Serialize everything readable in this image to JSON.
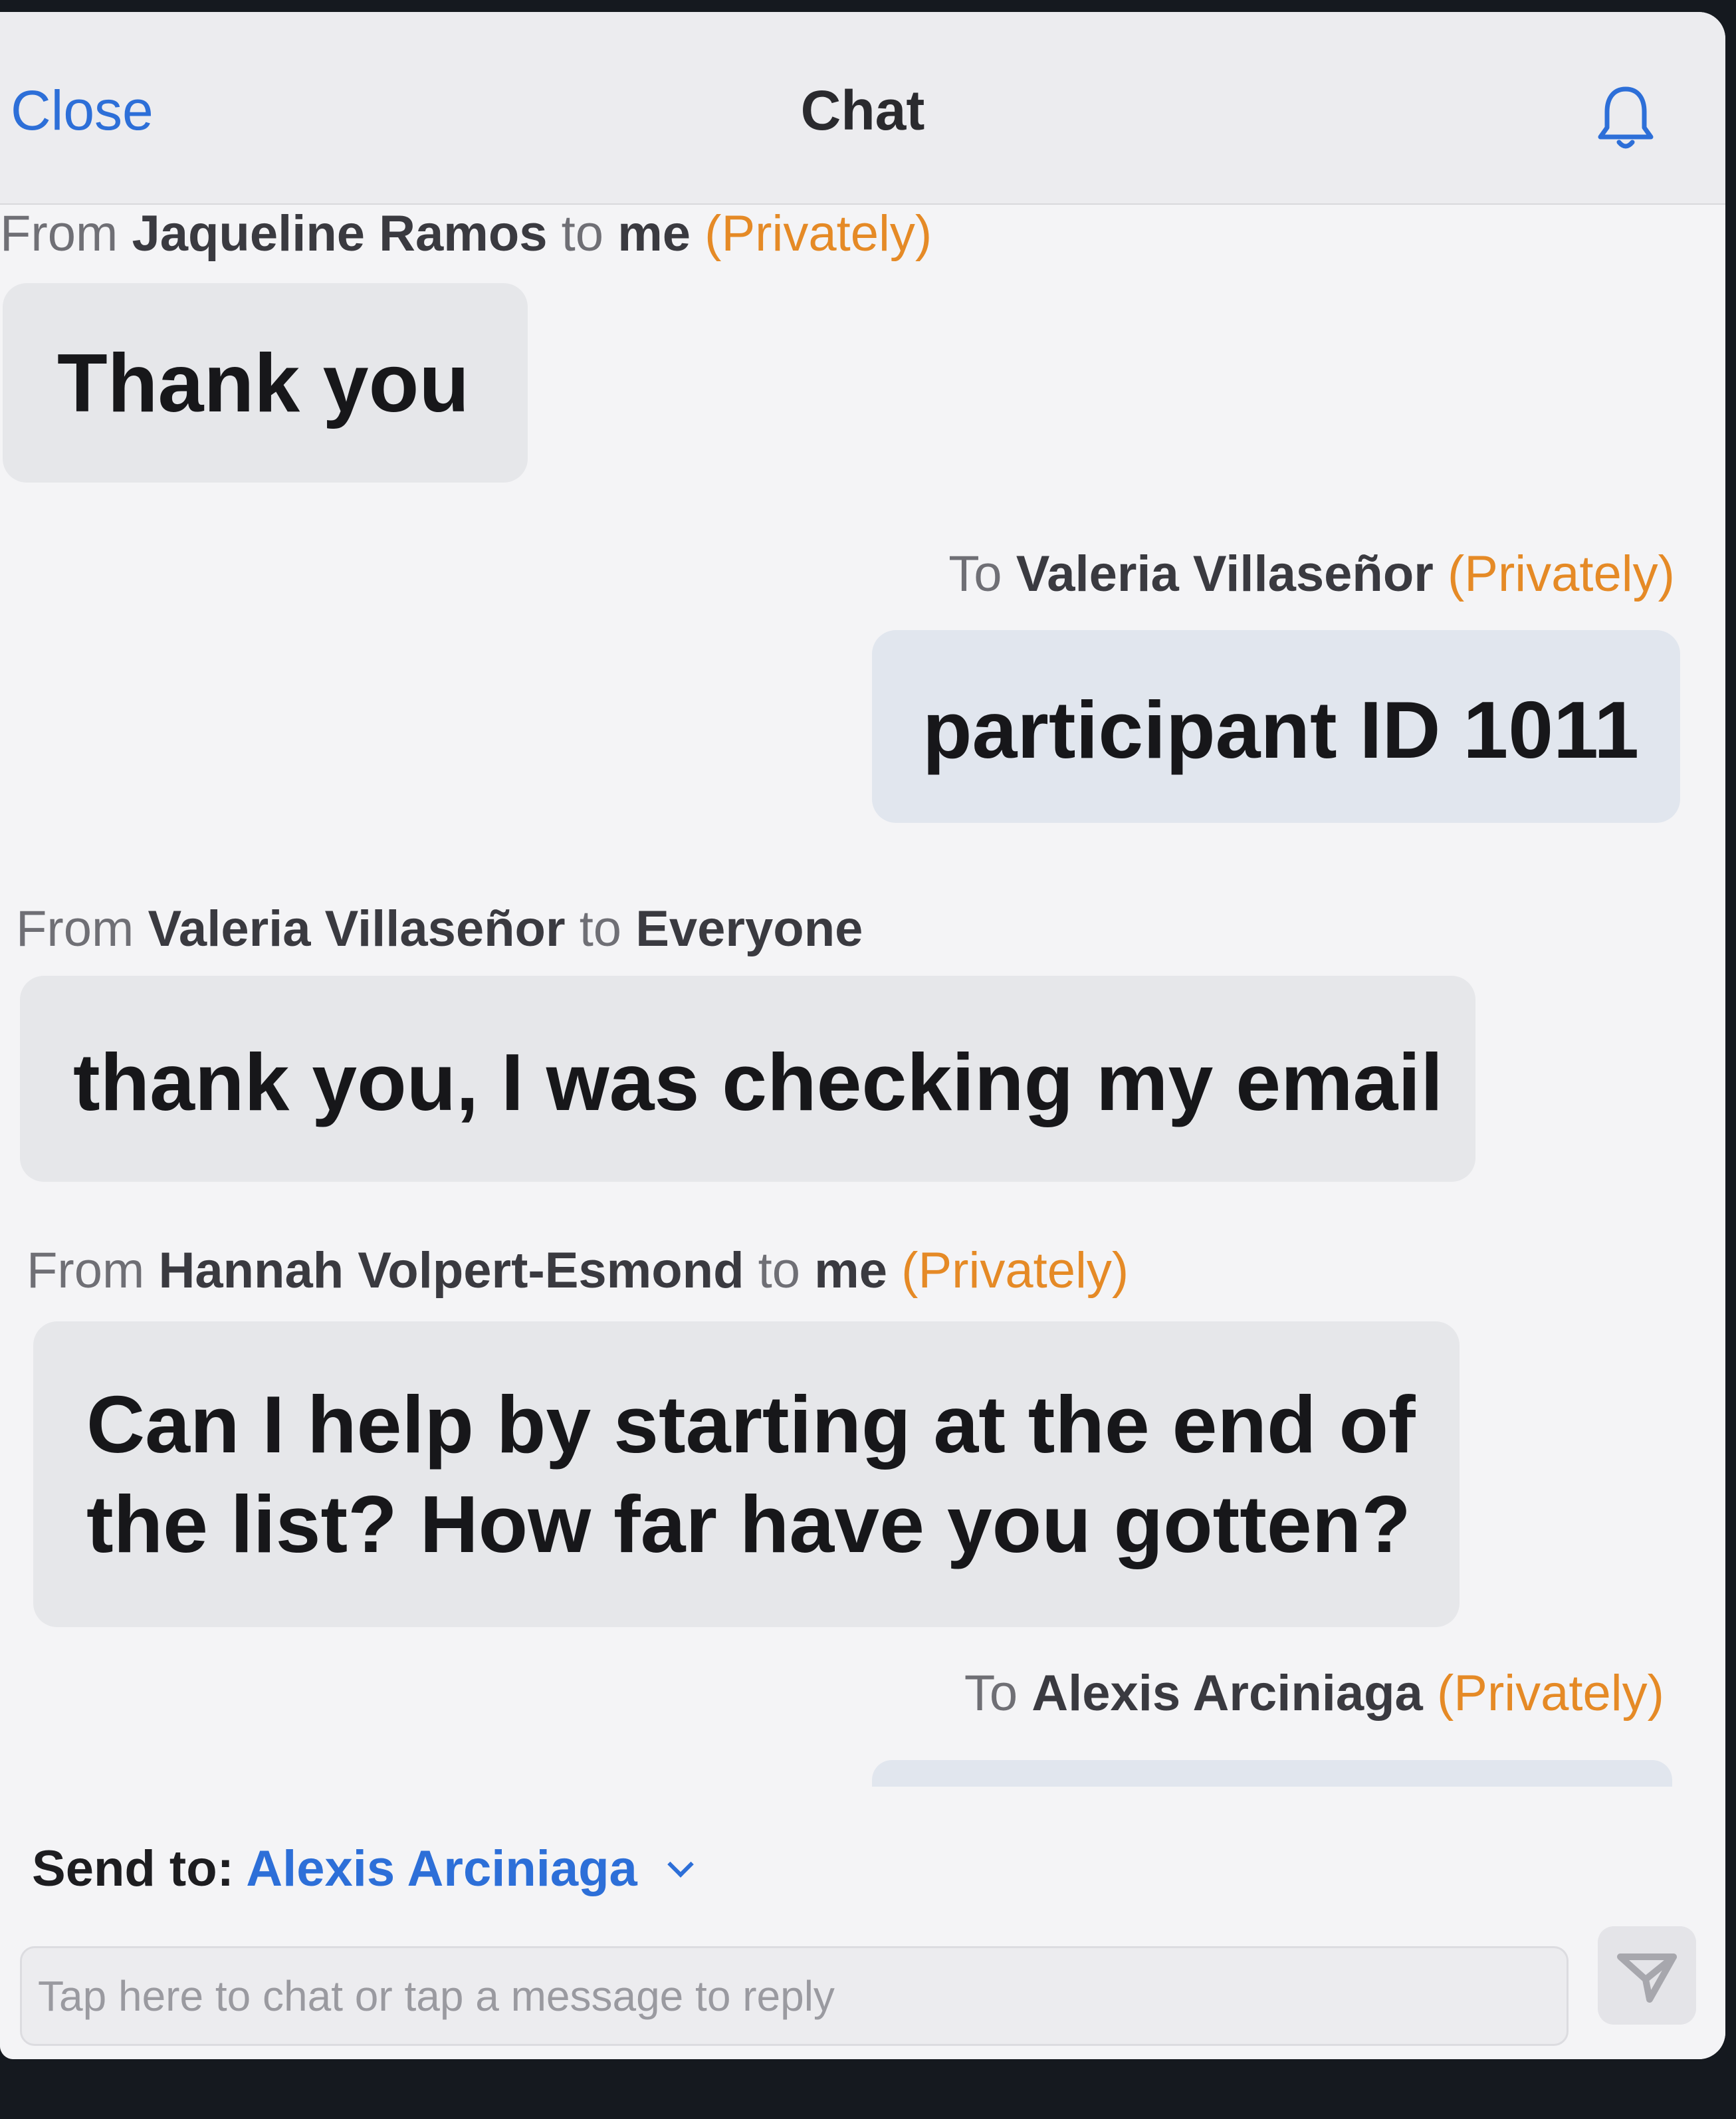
{
  "header": {
    "close_label": "Close",
    "title": "Chat",
    "bell_icon": "bell-icon"
  },
  "messages": [
    {
      "direction": "incoming",
      "prefix": "From",
      "sender": "Jaqueline Ramos",
      "to_word": "to",
      "recipient": "me",
      "privacy": "(Privately)",
      "text": "Thank you"
    },
    {
      "direction": "outgoing",
      "prefix": "To",
      "recipient": "Valeria Villaseñor",
      "privacy": "(Privately)",
      "text": "participant ID 1011"
    },
    {
      "direction": "incoming",
      "prefix": "From",
      "sender": "Valeria Villaseñor",
      "to_word": "to",
      "recipient": "Everyone",
      "text": "thank you, I was checking my email"
    },
    {
      "direction": "incoming",
      "prefix": "From",
      "sender": "Hannah Volpert-Esmond",
      "to_word": "to",
      "recipient": "me",
      "privacy": "(Privately)",
      "text_line1": "Can I help by starting at the end of",
      "text_line2": "the list? How far have you gotten?"
    },
    {
      "direction": "outgoing",
      "prefix": "To",
      "recipient": "Alexis Arciniaga",
      "privacy": "(Privately)"
    }
  ],
  "composer": {
    "send_to_label": "Send to:",
    "send_to_value": "Alexis Arciniaga",
    "placeholder": "Tap here to chat or tap a message to reply",
    "send_icon": "send-icon",
    "chevron_icon": "chevron-down-icon"
  },
  "colors": {
    "accent": "#2d6fd8",
    "privately": "#e58a26",
    "bubble": "#e6e7ea",
    "header_bg": "#ececef"
  }
}
